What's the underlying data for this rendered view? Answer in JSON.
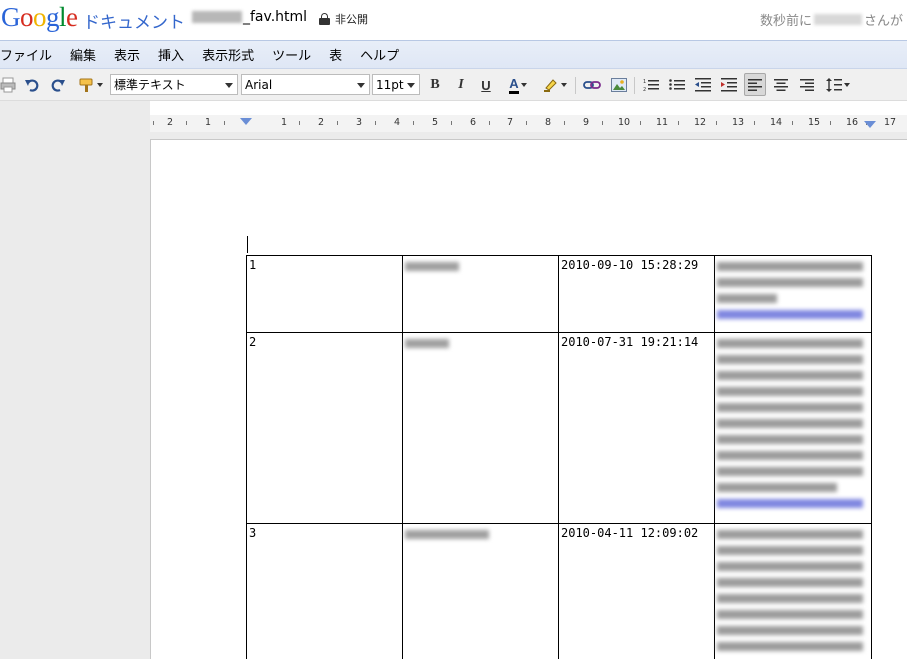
{
  "header": {
    "logo_letters": [
      {
        "ch": "G",
        "color": "#2a64d8"
      },
      {
        "ch": "o",
        "color": "#d62d20"
      },
      {
        "ch": "o",
        "color": "#f0b400"
      },
      {
        "ch": "g",
        "color": "#2a64d8"
      },
      {
        "ch": "l",
        "color": "#008a2e"
      },
      {
        "ch": "e",
        "color": "#d62d20"
      }
    ],
    "app_name": "ドキュメント",
    "doc_title_suffix": "_fav.html",
    "privacy": "非公開",
    "last_edit_prefix": "数秒前に",
    "last_edit_suffix": "さんが"
  },
  "menu": [
    "ファイル",
    "編集",
    "表示",
    "挿入",
    "表示形式",
    "ツール",
    "表",
    "ヘルプ"
  ],
  "toolbar": {
    "style_value": "標準テキスト",
    "font_value": "Arial",
    "size_value": "11pt",
    "bold": "B",
    "italic": "I",
    "underline": "U",
    "text_color": "A",
    "icons": [
      "print-icon",
      "undo-icon",
      "redo-icon",
      "paint-format-icon",
      "link-icon",
      "image-icon",
      "numbered-list-icon",
      "bulleted-list-icon",
      "decrease-indent-icon",
      "increase-indent-icon",
      "align-left-icon",
      "align-center-icon",
      "align-right-icon",
      "line-spacing-icon"
    ]
  },
  "ruler": {
    "labels": [
      "2",
      "1",
      "1",
      "2",
      "3",
      "4",
      "5",
      "6",
      "7",
      "8",
      "9",
      "10",
      "11",
      "12",
      "13",
      "14",
      "15",
      "16",
      "17"
    ]
  },
  "table": {
    "rows": [
      {
        "num": "1",
        "date": "2010-09-10 15:28:29"
      },
      {
        "num": "2",
        "date": "2010-07-31 19:21:14"
      },
      {
        "num": "3",
        "date": "2010-04-11 12:09:02"
      }
    ]
  }
}
